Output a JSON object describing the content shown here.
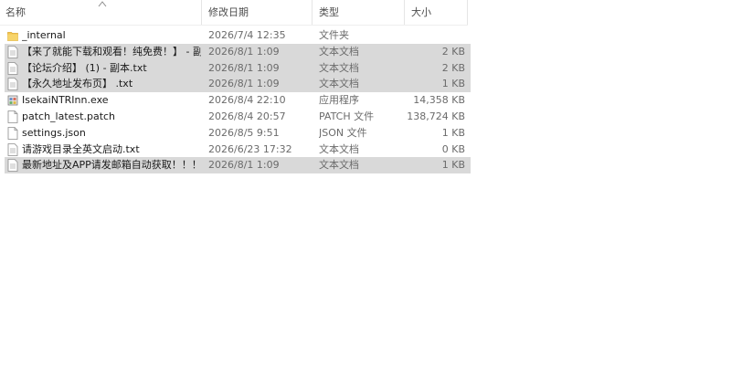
{
  "columns": {
    "name": "名称",
    "date": "修改日期",
    "type": "类型",
    "size": "大小"
  },
  "files": [
    {
      "name": "_internal",
      "date": "2026/7/4 12:35",
      "type": "文件夹",
      "size": "",
      "icon": "folder-icon",
      "selected": false
    },
    {
      "name": "【来了就能下载和观看！纯免费！】 - 副...",
      "date": "2026/8/1 1:09",
      "type": "文本文档",
      "size": "2 KB",
      "icon": "text-file-icon",
      "selected": true
    },
    {
      "name": "【论坛介绍】 (1) - 副本.txt",
      "date": "2026/8/1 1:09",
      "type": "文本文档",
      "size": "2 KB",
      "icon": "text-file-icon",
      "selected": true
    },
    {
      "name": "【永久地址发布页】 .txt",
      "date": "2026/8/1 1:09",
      "type": "文本文档",
      "size": "1 KB",
      "icon": "text-file-icon",
      "selected": true
    },
    {
      "name": "IsekaiNTRInn.exe",
      "date": "2026/8/4 22:10",
      "type": "应用程序",
      "size": "14,358 KB",
      "icon": "exe-file-icon",
      "selected": false
    },
    {
      "name": "patch_latest.patch",
      "date": "2026/8/4 20:57",
      "type": "PATCH 文件",
      "size": "138,724 KB",
      "icon": "blank-file-icon",
      "selected": false
    },
    {
      "name": "settings.json",
      "date": "2026/8/5 9:51",
      "type": "JSON 文件",
      "size": "1 KB",
      "icon": "blank-file-icon",
      "selected": false
    },
    {
      "name": "请游戏目录全英文启动.txt",
      "date": "2026/6/23 17:32",
      "type": "文本文档",
      "size": "0 KB",
      "icon": "text-file-icon",
      "selected": false
    },
    {
      "name": "最新地址及APP请发邮箱自动获取！！！...",
      "date": "2026/8/1 1:09",
      "type": "文本文档",
      "size": "1 KB",
      "icon": "text-file-icon",
      "selected": true
    }
  ]
}
